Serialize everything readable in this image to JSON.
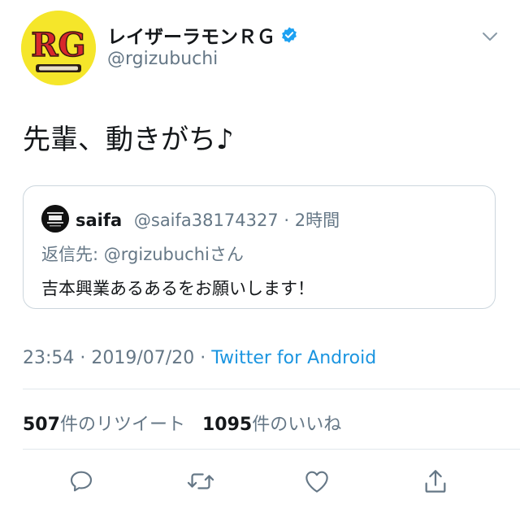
{
  "author": {
    "display_name": "レイザーラモンＲＧ",
    "handle": "@rgizubuchi",
    "avatar_text": "RG"
  },
  "tweet": {
    "text": "先輩、動きがち♪"
  },
  "quoted": {
    "name": "saifa",
    "handle": "@saifa38174327",
    "separator": " · ",
    "time": "2時間",
    "reply_prefix": "返信先: ",
    "reply_mention": "@rgizubuchi",
    "reply_suffix": "さん",
    "text": "吉本興業あるあるをお願いします！"
  },
  "meta": {
    "time": "23:54",
    "sep1": " · ",
    "date": "2019/07/20",
    "sep2": " · ",
    "source": "Twitter for Android"
  },
  "stats": {
    "retweets_count": "507",
    "retweets_label": "件のリツイート",
    "likes_count": "1095",
    "likes_label": "件のいいね"
  },
  "colors": {
    "accent": "#1b95e0",
    "muted": "#657786",
    "border": "#ccd6dd",
    "avatar_bg": "#f5e62a",
    "avatar_red": "#d8282b"
  },
  "icons": {
    "reply": "reply-icon",
    "retweet": "retweet-icon",
    "like": "heart-icon",
    "share": "share-icon",
    "menu": "chevron-down-icon",
    "verified": "verified-badge-icon"
  }
}
